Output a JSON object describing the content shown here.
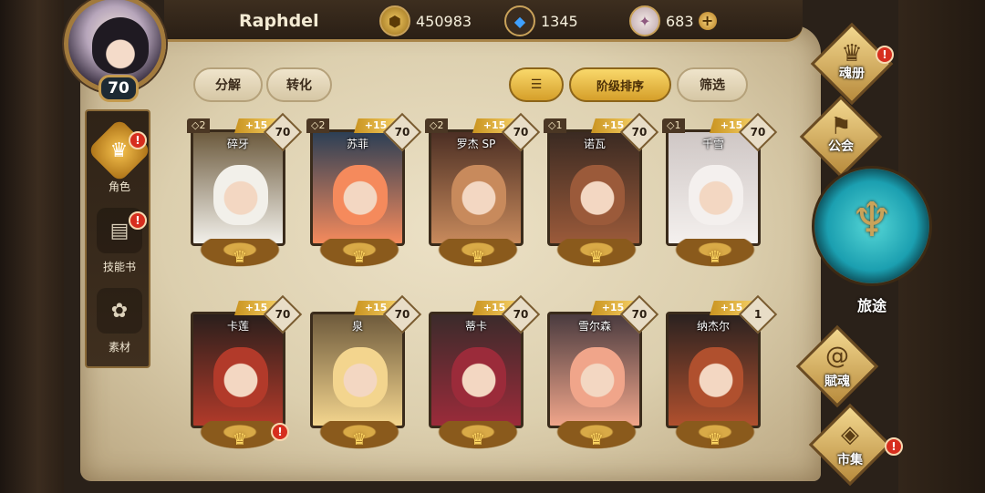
{
  "player": {
    "name": "Raphdel",
    "level": "70"
  },
  "currency": {
    "gold": {
      "value": "450983",
      "icon": "gold-coin-icon"
    },
    "crystal": {
      "value": "1345",
      "icon": "blue-crystal-icon"
    },
    "gem": {
      "value": "683",
      "icon": "pink-gem-icon"
    },
    "add_label": "+"
  },
  "left_nav": [
    {
      "label": "角色",
      "icon": "helmet-icon",
      "alert": "!"
    },
    {
      "label": "技能书",
      "icon": "skill-book-icon",
      "alert": "!"
    },
    {
      "label": "素材",
      "icon": "material-icon"
    }
  ],
  "toolbar": {
    "decompose": "分解",
    "convert": "转化",
    "sort_order": "阶级排序",
    "filter": "筛选"
  },
  "cards": [
    {
      "name": "碎牙",
      "stars": "◇2",
      "bonus": "+15",
      "level": "70",
      "palette": "bear"
    },
    {
      "name": "苏菲",
      "stars": "◇2",
      "bonus": "+15",
      "level": "70",
      "palette": "sophie"
    },
    {
      "name": "罗杰 SP",
      "stars": "◇2",
      "bonus": "+15",
      "level": "70",
      "palette": "roger"
    },
    {
      "name": "诺瓦",
      "stars": "◇1",
      "bonus": "+15",
      "level": "70",
      "palette": "nova"
    },
    {
      "name": "千雪",
      "stars": "◇1",
      "bonus": "+15",
      "level": "70",
      "palette": "chiyuki"
    },
    {
      "name": "卡莲",
      "stars": "",
      "bonus": "+15",
      "level": "70",
      "palette": "karen",
      "alert": "!"
    },
    {
      "name": "泉",
      "stars": "",
      "bonus": "+15",
      "level": "70",
      "palette": "izumi"
    },
    {
      "name": "蒂卡",
      "stars": "",
      "bonus": "+15",
      "level": "70",
      "palette": "tika"
    },
    {
      "name": "雪尔森",
      "stars": "",
      "bonus": "+15",
      "level": "70",
      "palette": "shelsen"
    },
    {
      "name": "纳杰尔",
      "stars": "",
      "bonus": "+15",
      "level": "1",
      "palette": "najel"
    }
  ],
  "right_nav": {
    "soul_book": {
      "label": "魂册",
      "icon": "helmet-icon",
      "alert": "!"
    },
    "guild": {
      "label": "公会",
      "icon": "guild-banner-icon"
    },
    "journey": {
      "label": "旅途",
      "icon": "trident-emblem-icon"
    },
    "soul_grant": {
      "label": "賦魂",
      "icon": "swirl-icon"
    },
    "market": {
      "label": "市集",
      "icon": "diamond-gem-icon",
      "alert": "!"
    }
  },
  "sort_icon": "sort-lines-icon"
}
